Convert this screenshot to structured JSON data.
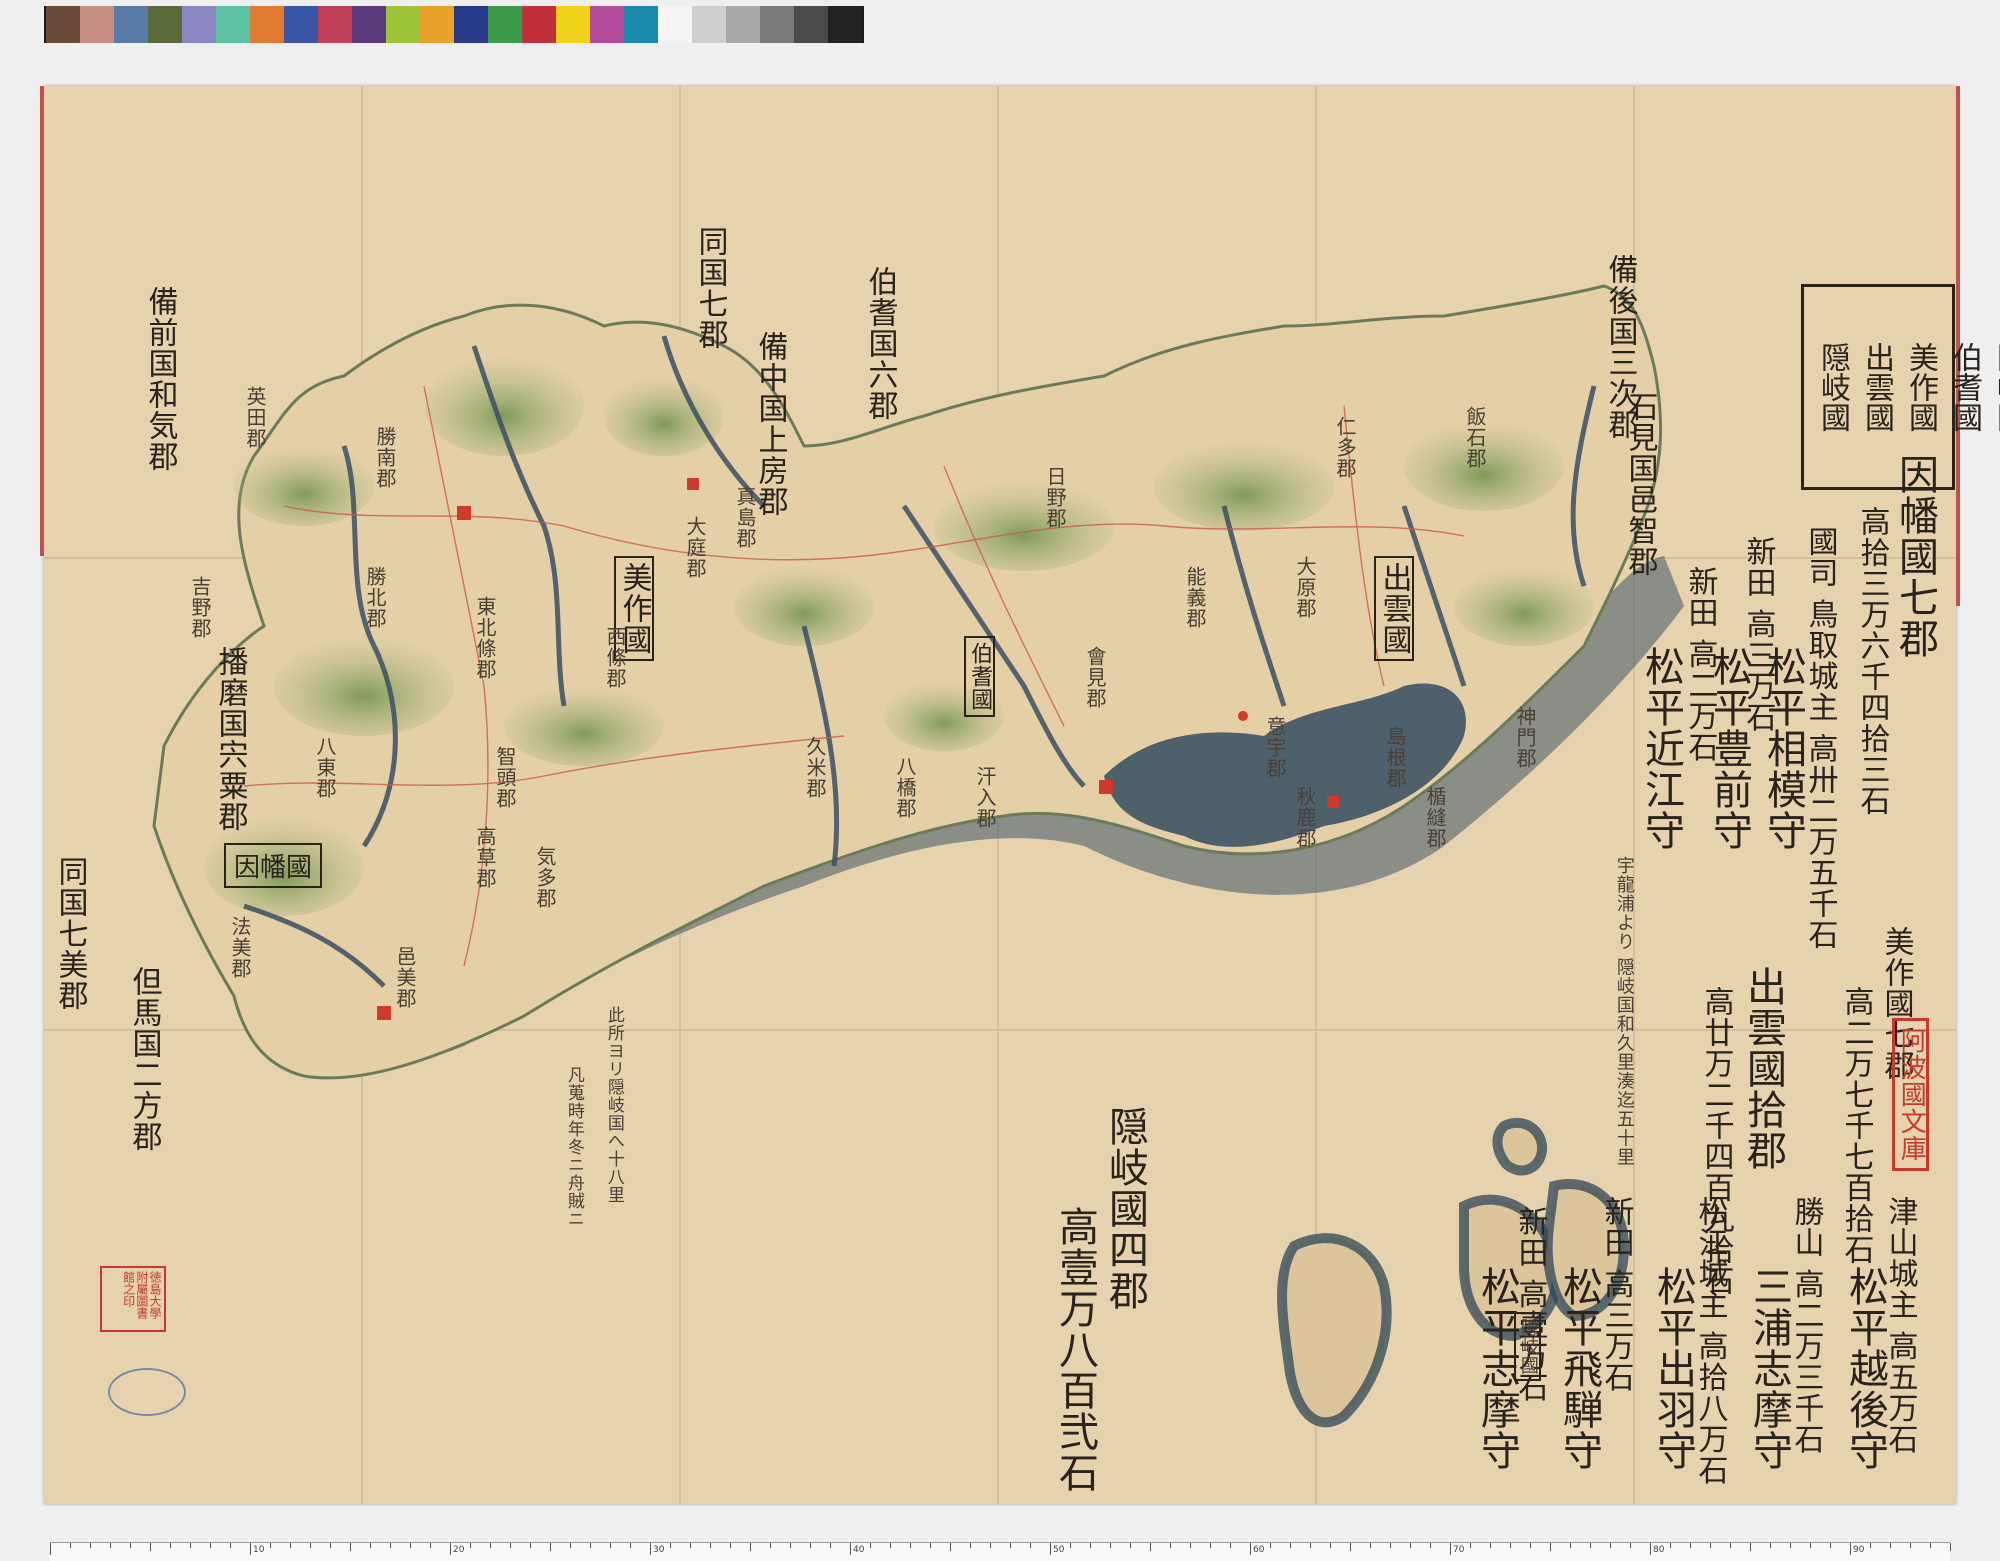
{
  "colorbar": {
    "swatches": [
      "#6b4a3a",
      "#c98e82",
      "#5a7aa8",
      "#5a6a3a",
      "#8a86c2",
      "#5ec2a4",
      "#e07a2e",
      "#3a54a6",
      "#c0405a",
      "#5a3a7a",
      "#9ec43a",
      "#e8a22a",
      "#2a3a8a",
      "#3a9a4a",
      "#c0303a",
      "#f0d21a",
      "#b64a9a",
      "#1a8aaa",
      "#f4f4f4",
      "#cfcfcf",
      "#a8a8a8",
      "#7a7a7a",
      "#4a4a4a",
      "#222222"
    ]
  },
  "legend": {
    "items": [
      "因幡國",
      "伯耆國",
      "美作國",
      "出雲國",
      "隠岐國"
    ]
  },
  "summary": {
    "inaba_title": "因幡國七郡",
    "inaba_koku": "高拾三万六千四拾三石",
    "inaba_castle": "國司 鳥取城主 高卅二万五千石",
    "inaba_lord": "松平相模守",
    "shinden1": "新田 高三万石",
    "lord_buzen": "松平豊前守",
    "shinden2": "新田 高二万石",
    "lord_omi": "松平近江守",
    "mimasaka_title": "美作國七郡",
    "mimasaka_koku": "高二万七千七百拾石",
    "izumo_title": "出雲國拾郡",
    "izumo_koku": "高廿万二千四百九拾石",
    "tsuyama": "津山城主 高五万石",
    "tsuyama_lord": "松平越後守",
    "katsuyama": "勝山 高二万三千石",
    "katsuyama_lord": "三浦志摩守",
    "matsue": "松江城主 高拾八万石",
    "matsue_lord": "松平出羽守",
    "shinden3": "新田 高三万石",
    "hida_lord": "松平飛騨守",
    "shinden4": "新田 高壹万石",
    "shima_lord": "松平志摩守",
    "oki_title": "隠岐國四郡",
    "oki_koku": "高壹万八百弐石"
  },
  "neighbors": {
    "bizen": "備前国和気郡",
    "harima": "播磨国宍粟郡",
    "tajima": "但馬国二方郡",
    "inaba_south": "同国七美郡",
    "bicchu": "備中国上房郡",
    "bingo": "備後国三次郡",
    "iwami": "石見国邑智郡",
    "hoki_note": "伯耆国六郡",
    "bottom_left": "同国七郡"
  },
  "provinces": {
    "mimasaka": "美作國",
    "inaba": "因幡國",
    "hoki": "伯耆國",
    "izumo": "出雲國",
    "oki": "隠岐國"
  },
  "districts": [
    "英田郡",
    "勝南郡",
    "勝北郡",
    "吉野郡",
    "東北條郡",
    "西條郡",
    "大庭郡",
    "真島郡",
    "智頭郡",
    "八東郡",
    "法美郡",
    "邑美郡",
    "高草郡",
    "気多郡",
    "久米郡",
    "八橋郡",
    "汗入郡",
    "會見郡",
    "日野郡",
    "能義郡",
    "大原郡",
    "仁多郡",
    "飯石郡",
    "意宇郡",
    "島根郡",
    "秋鹿郡",
    "楯縫郡",
    "神門郡"
  ],
  "notes": {
    "sea1": "此所ヨリ隠岐国へ十八里",
    "sea2": "凡蒐時年冬ニ舟賊ニ",
    "oki_distance": "宇龍浦より 隠岐国和久里湊迄五十里"
  },
  "stamps": {
    "awa": "阿波國文庫",
    "univ": "徳島大學附屬圖書館之印"
  },
  "ruler": {
    "labels": [
      "10",
      "20",
      "30",
      "40",
      "50",
      "60",
      "70",
      "80",
      "90"
    ]
  }
}
